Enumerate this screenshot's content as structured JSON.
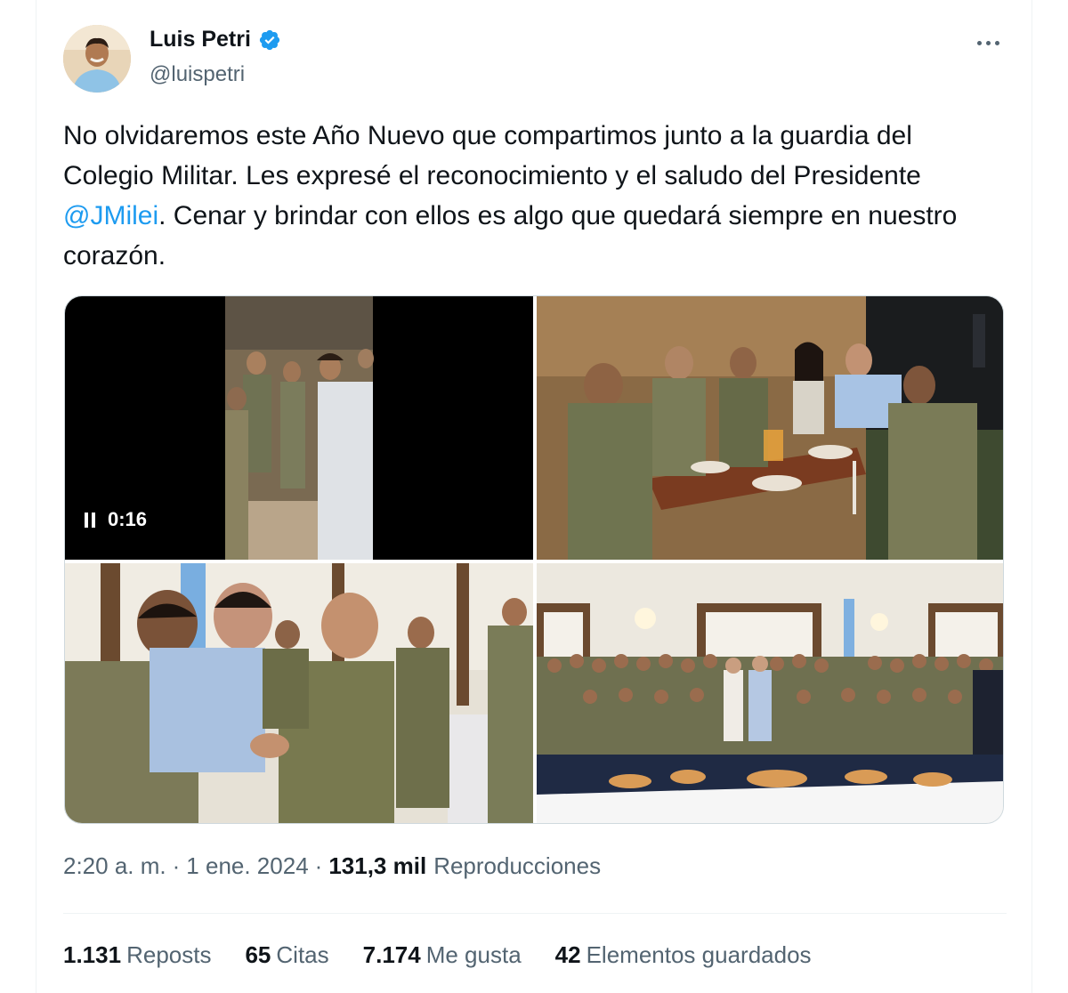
{
  "author": {
    "display_name": "Luis Petri",
    "handle": "@luispetri",
    "verified": true
  },
  "tweet": {
    "text_part1": "No olvidaremos este Año Nuevo que compartimos junto a la guardia del Colegio Militar. Les expresé el reconocimiento y el saludo del Presidente ",
    "mention": "@JMilei",
    "text_part2": ". Cenar y brindar con ellos es algo que quedará siempre en nuestro corazón."
  },
  "media": {
    "video_time": "0:16"
  },
  "meta": {
    "time": "2:20 a. m.",
    "date": "1 ene. 2024",
    "views_count": "131,3 mil",
    "views_label": "Reproducciones"
  },
  "stats": [
    {
      "count": "1.131",
      "label": "Reposts"
    },
    {
      "count": "65",
      "label": "Citas"
    },
    {
      "count": "7.174",
      "label": "Me gusta"
    },
    {
      "count": "42",
      "label": "Elementos guardados"
    }
  ],
  "colors": {
    "accent": "#1d9bf0",
    "text": "#0f1419",
    "secondary": "#536471"
  },
  "icons": {
    "verified": "verified-badge-icon",
    "more": "more-options-icon",
    "pause": "pause-icon"
  }
}
